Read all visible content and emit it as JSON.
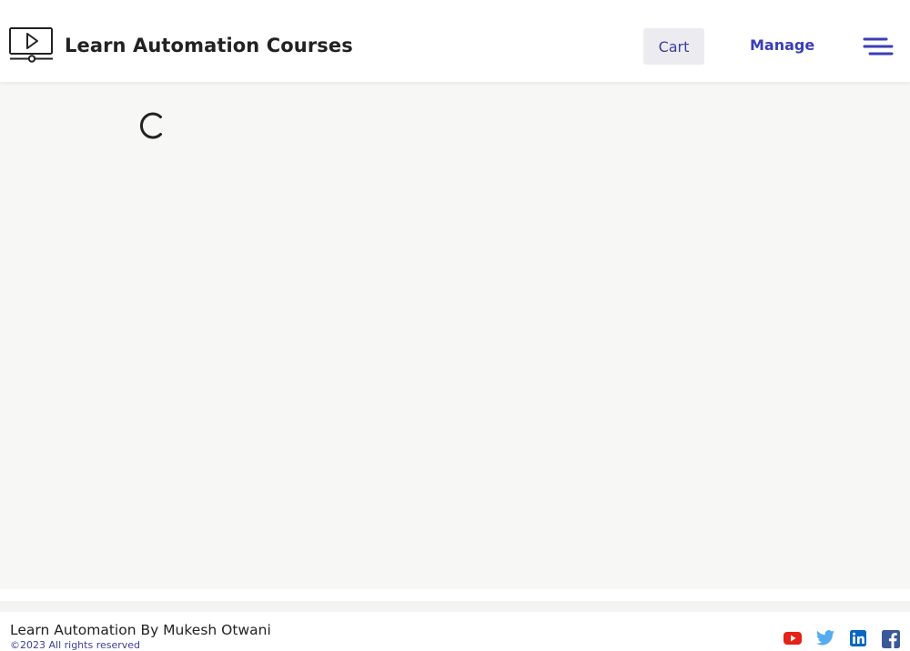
{
  "header": {
    "brand_title": "Learn Automation Courses",
    "brand_icon": "video-player-icon",
    "cart_label": "Cart",
    "manage_label": "Manage",
    "menu_icon": "hamburger-menu-icon"
  },
  "main": {
    "loading_icon": "loading-spinner-icon"
  },
  "footer": {
    "title": "Learn Automation By Mukesh Otwani",
    "copyright": "©2023 All rights reserved",
    "social": [
      {
        "name": "youtube-icon",
        "color": "#e62117"
      },
      {
        "name": "twitter-icon",
        "color": "#55acee"
      },
      {
        "name": "linkedin-icon",
        "color": "#0a66c2"
      },
      {
        "name": "facebook-icon",
        "color": "#3b5998"
      }
    ]
  },
  "colors": {
    "accent": "#3a3eb8",
    "cart_bg": "#ececf0",
    "main_bg": "#f7f8f6",
    "text": "#222222"
  }
}
